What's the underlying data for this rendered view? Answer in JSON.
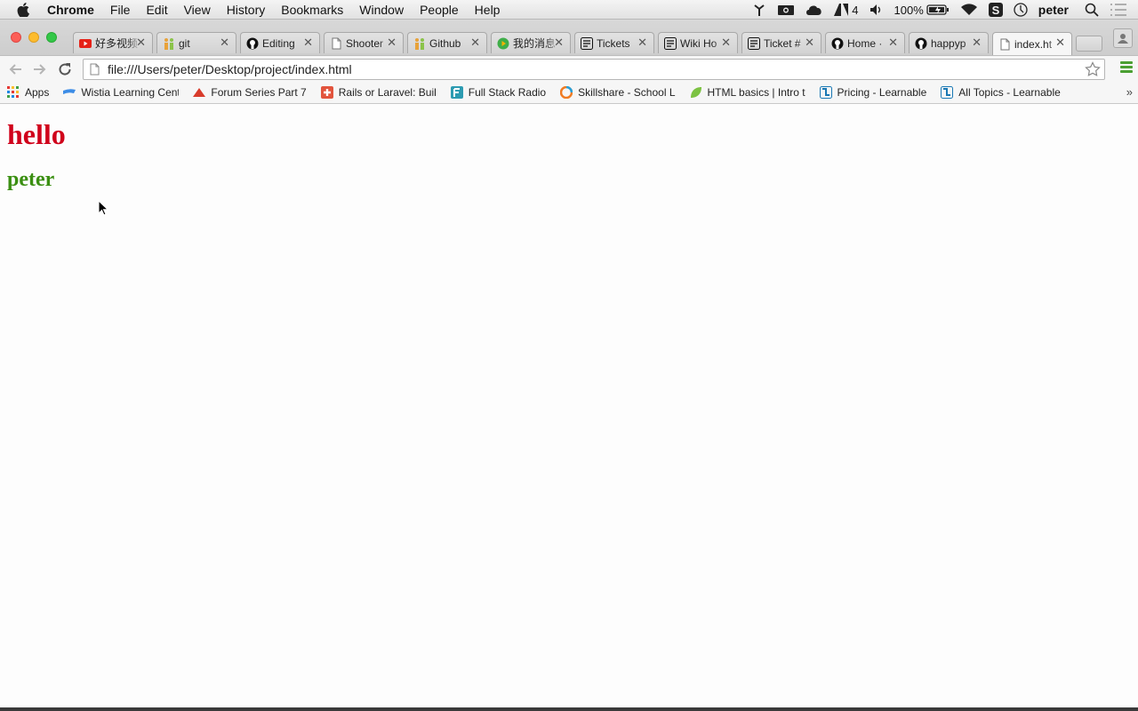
{
  "menubar": {
    "app_name": "Chrome",
    "items": [
      "File",
      "Edit",
      "View",
      "History",
      "Bookmarks",
      "Window",
      "People",
      "Help"
    ],
    "status": {
      "adobe_badge": "4",
      "battery_percent": "100%",
      "user": "peter"
    }
  },
  "tabs": [
    {
      "title": "好多视频",
      "icon": "youtube-icon",
      "color": "#e62117"
    },
    {
      "title": "git",
      "icon": "people-icon",
      "color": "#e8a23a"
    },
    {
      "title": "Editing",
      "icon": "github-icon",
      "color": "#111111"
    },
    {
      "title": "Shooter",
      "icon": "page-icon",
      "color": "#777777"
    },
    {
      "title": "Github",
      "icon": "people-icon",
      "color": "#e8a23a"
    },
    {
      "title": "我的消息",
      "icon": "play-icon",
      "color": "#3fae49"
    },
    {
      "title": "Tickets",
      "icon": "ticket-icon",
      "color": "#111111"
    },
    {
      "title": "Wiki Ho",
      "icon": "ticket-icon",
      "color": "#111111"
    },
    {
      "title": "Ticket #",
      "icon": "ticket-icon",
      "color": "#111111"
    },
    {
      "title": "Home ·",
      "icon": "github-icon",
      "color": "#111111"
    },
    {
      "title": "happyp",
      "icon": "github-icon",
      "color": "#111111"
    },
    {
      "title": "index.ht",
      "icon": "page-icon",
      "color": "#777777",
      "active": true
    }
  ],
  "toolbar": {
    "url": "file:///Users/peter/Desktop/project/index.html"
  },
  "bookmarks": [
    {
      "label": "Apps",
      "icon": "apps-grid-icon"
    },
    {
      "label": "Wistia Learning Cent",
      "icon": "wistia-icon"
    },
    {
      "label": "Forum Series Part 7",
      "icon": "laracasts-icon"
    },
    {
      "label": "Rails or Laravel: Buil",
      "icon": "plus-box-icon"
    },
    {
      "label": "Full Stack Radio",
      "icon": "f-icon"
    },
    {
      "label": "Skillshare - School L",
      "icon": "skillshare-icon"
    },
    {
      "label": "HTML basics | Intro t",
      "icon": "leaf-icon"
    },
    {
      "label": "Pricing - Learnable",
      "icon": "learnable-icon"
    },
    {
      "label": "All Topics - Learnable",
      "icon": "learnable-icon"
    }
  ],
  "page": {
    "heading": "hello",
    "subheading": "peter",
    "heading_color": "#d0021b",
    "subheading_color": "#3b8f12"
  }
}
